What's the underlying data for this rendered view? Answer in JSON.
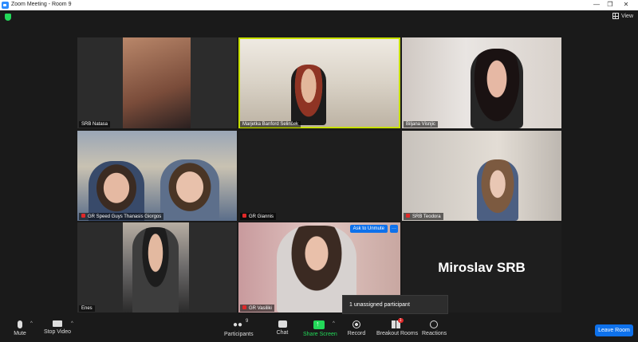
{
  "window": {
    "title": "Zoom Meeting - Room 9",
    "min": "—",
    "max": "❐",
    "close": "✕"
  },
  "view_button": {
    "label": "View"
  },
  "tiles": [
    {
      "name": "SRB Natasa",
      "muted": false
    },
    {
      "name": "Marjetka Banford Selinšek",
      "muted": false
    },
    {
      "name": "Biljana Visnjic",
      "muted": false
    },
    {
      "name": "GR Speed Guys Thanasis Giorgos",
      "muted": true
    },
    {
      "name": "GR Giannis",
      "muted": true
    },
    {
      "name": "SRB Teodora",
      "muted": true
    },
    {
      "name": "Enes",
      "muted": false
    },
    {
      "name": "GR Vasiliki",
      "muted": true
    },
    {
      "name": "Miroslav SRB",
      "muted": false
    }
  ],
  "overlay": {
    "ask_to_unmute": "Ask to Unmute",
    "more": "···"
  },
  "tooltip": {
    "text": "1 unassigned participant"
  },
  "toolbar": {
    "mute": "Mute",
    "stop_video": "Stop Video",
    "participants": "Participants",
    "participants_count": "9",
    "chat": "Chat",
    "share_screen": "Share Screen",
    "record": "Record",
    "breakout_rooms": "Breakout Rooms",
    "breakout_badge": "1",
    "reactions": "Reactions",
    "leave": "Leave Room"
  },
  "colors": {
    "accent": "#0e71eb",
    "active_speaker": "#c7e000",
    "green": "#23d959",
    "muted_red": "#e02828"
  }
}
